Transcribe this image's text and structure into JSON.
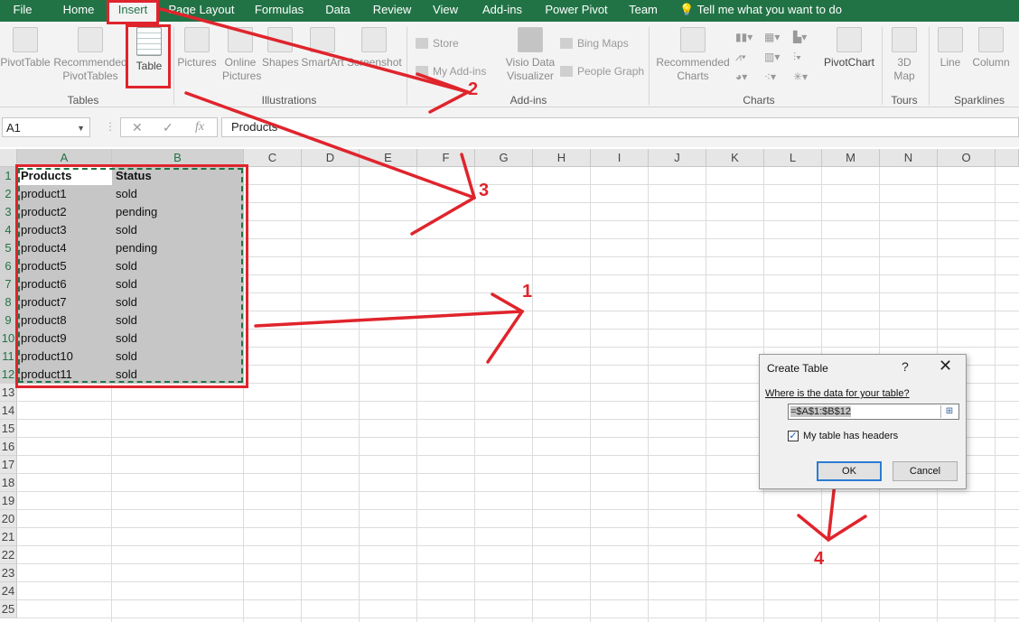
{
  "menu": {
    "items": [
      "File",
      "Home",
      "Insert",
      "Page Layout",
      "Formulas",
      "Data",
      "Review",
      "View",
      "Add-ins",
      "Power Pivot",
      "Team"
    ],
    "tell_me": "Tell me what you want to do",
    "active": "Insert"
  },
  "ribbon": {
    "pivot_table": "PivotTable",
    "recommended_pivot_1": "Recommended",
    "recommended_pivot_2": "PivotTables",
    "table": "Table",
    "group_tables": "Tables",
    "pictures": "Pictures",
    "online_pictures_1": "Online",
    "online_pictures_2": "Pictures",
    "shapes": "Shapes",
    "smartart": "SmartArt",
    "screenshot": "Screenshot",
    "group_illustrations": "Illustrations",
    "store": "Store",
    "my_addins": "My Add-ins",
    "visio_1": "Visio Data",
    "visio_2": "Visualizer",
    "bing_maps": "Bing Maps",
    "people_graph": "People Graph",
    "group_addins": "Add-ins",
    "recommended_charts_1": "Recommended",
    "recommended_charts_2": "Charts",
    "pivot_chart": "PivotChart",
    "group_charts": "Charts",
    "map3d_1": "3D",
    "map3d_2": "Map",
    "group_tours": "Tours",
    "line": "Line",
    "column": "Column",
    "group_sparklines": "Sparklines"
  },
  "formula_bar": {
    "name_box": "A1",
    "cancel": "✕",
    "enter": "✓",
    "fx": "fx",
    "content": "Products"
  },
  "sheet": {
    "columns": [
      "A",
      "B",
      "C",
      "D",
      "E",
      "F",
      "G",
      "H",
      "I",
      "J",
      "K",
      "L",
      "M",
      "N",
      "O"
    ],
    "rows": [
      "1",
      "2",
      "3",
      "4",
      "5",
      "6",
      "7",
      "8",
      "9",
      "10",
      "11",
      "12",
      "13",
      "14",
      "15",
      "16",
      "17",
      "18",
      "19",
      "20",
      "21",
      "22",
      "23",
      "24",
      "25"
    ],
    "header_a": "Products",
    "header_b": "Status",
    "data": [
      [
        "product1",
        "sold"
      ],
      [
        "product2",
        "pending"
      ],
      [
        "product3",
        "sold"
      ],
      [
        "product4",
        "pending"
      ],
      [
        "product5",
        "sold"
      ],
      [
        "product6",
        "sold"
      ],
      [
        "product7",
        "sold"
      ],
      [
        "product8",
        "sold"
      ],
      [
        "product9",
        "sold"
      ],
      [
        "product10",
        "sold"
      ],
      [
        "product11",
        "sold"
      ]
    ]
  },
  "dialog": {
    "title": "Create Table",
    "help": "?",
    "close": "✕",
    "prompt": "Where is the data for your table?",
    "range": "=$A$1:$B$12",
    "checkbox_label": "My table has headers",
    "checkbox_checked": true,
    "ok": "OK",
    "cancel": "Cancel"
  },
  "annotations": {
    "n1": "1",
    "n2": "2",
    "n3": "3",
    "n4": "4",
    "color": "#e0242c"
  }
}
